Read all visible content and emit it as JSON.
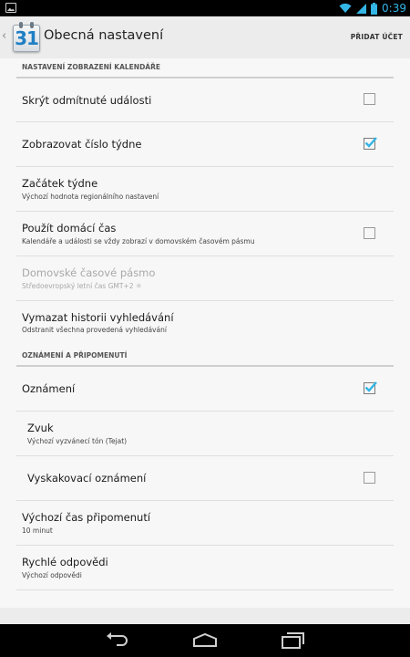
{
  "status_bar": {
    "time": "0:39"
  },
  "action_bar": {
    "app_icon_number": "31",
    "title": "Obecná nastavení",
    "add_account_label": "PŘIDAT ÚČET"
  },
  "sections": [
    {
      "header": "NASTAVENÍ ZOBRAZENÍ KALENDÁŘE"
    },
    {
      "header": "OZNÁMENÍ A PŘIPOMENUTÍ"
    }
  ],
  "settings": {
    "hide_declined": {
      "label": "Skrýt odmítnuté události",
      "checked": false
    },
    "show_week_number": {
      "label": "Zobrazovat číslo týdne",
      "checked": true
    },
    "week_start": {
      "label": "Začátek týdne",
      "summary": "Výchozí hodnota regionálního nastavení"
    },
    "use_home_time": {
      "label": "Použít domácí čas",
      "summary": "Kalendáře a události se vždy zobrazí v domovském časovém pásmu",
      "checked": false
    },
    "home_timezone": {
      "label": "Domovské časové pásmo",
      "summary": "Středoevropský letní čas  GMT+2",
      "enabled": false
    },
    "clear_search_history": {
      "label": "Vymazat historii vyhledávání",
      "summary": "Odstranit všechna provedená vyhledávání"
    },
    "notifications": {
      "label": "Oznámení",
      "checked": true
    },
    "sound": {
      "label": "Zvuk",
      "summary": "Výchozí vyzvánecí tón (Tejat)"
    },
    "popup_notification": {
      "label": "Vyskakovací oznámení",
      "checked": false
    },
    "default_reminder": {
      "label": "Výchozí čas připomenutí",
      "summary": "10 minut"
    },
    "quick_responses": {
      "label": "Rychlé odpovědi",
      "summary": "Výchozí odpovědi"
    }
  },
  "icons": {
    "notification": "image-notification-icon",
    "wifi": "wifi-icon",
    "signal": "cell-signal-icon",
    "battery": "battery-icon",
    "check": "checkmark-icon",
    "back": "back-icon",
    "home": "home-icon",
    "recents": "recent-apps-icon",
    "timezone_gear": "gear-icon"
  },
  "colors": {
    "accent": "#33b5e5",
    "check": "#33b5e5"
  }
}
